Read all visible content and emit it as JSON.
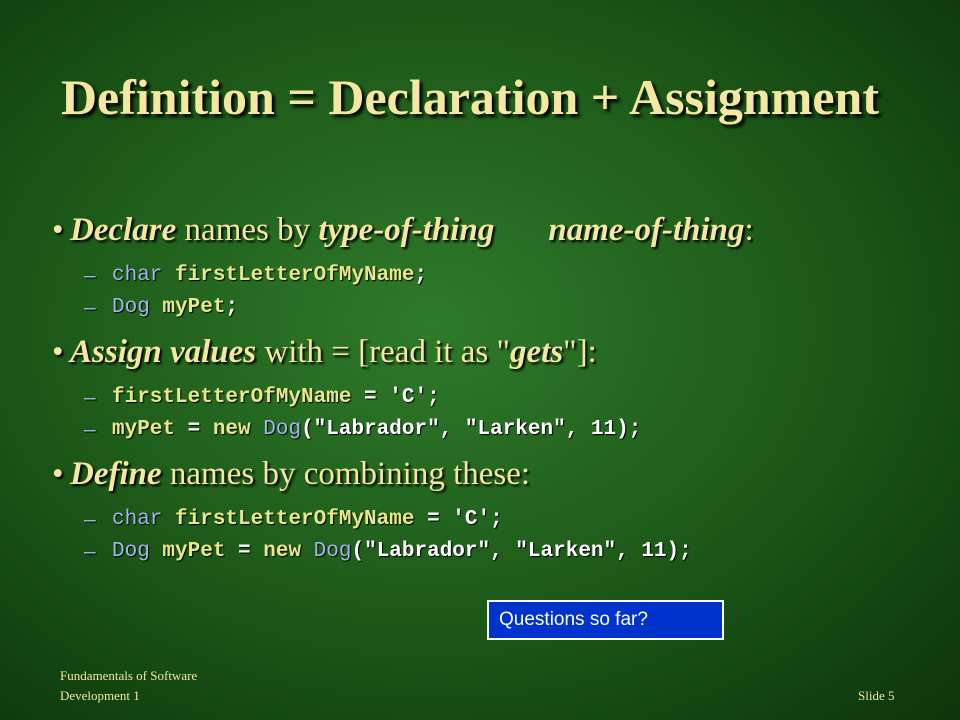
{
  "title": "Definition = Declaration + Assignment",
  "sections": [
    {
      "bullet_term": "Declare",
      "bullet_text": " names by ",
      "bullet_em1": "type-of-thing",
      "bullet_em2": "name-of-thing",
      "bullet_end": ":",
      "lines": [
        [
          "char",
          " firstLetterOfMyName",
          ";"
        ],
        [
          "Dog",
          " myPet",
          ";"
        ]
      ]
    },
    {
      "bullet_term": "Assign",
      "bullet_em_mid": "values",
      "bullet_text": " with = [read it as \"",
      "bullet_em_gets": "gets",
      "bullet_end": "\"]:",
      "lines": [
        [
          "firstLetterOfMyName",
          " = 'C';"
        ],
        [
          "myPet",
          " = ",
          "new",
          " Dog",
          "(\"Labrador\", \"Larken\", 11);"
        ]
      ]
    },
    {
      "bullet_term": "Define",
      "bullet_text": " names by combining these:",
      "lines": [
        [
          "char",
          " firstLetterOfMyName",
          " = 'C';"
        ],
        [
          "Dog",
          " myPet",
          " = ",
          "new",
          " Dog",
          "(\"Labrador\", \"Larken\", 11);"
        ]
      ]
    }
  ],
  "dash": "–",
  "questions_box": "Questions so far?",
  "footer": {
    "course_line1": "Fundamentals of Software",
    "course_line2": "Development 1",
    "slide": "Slide 5"
  }
}
